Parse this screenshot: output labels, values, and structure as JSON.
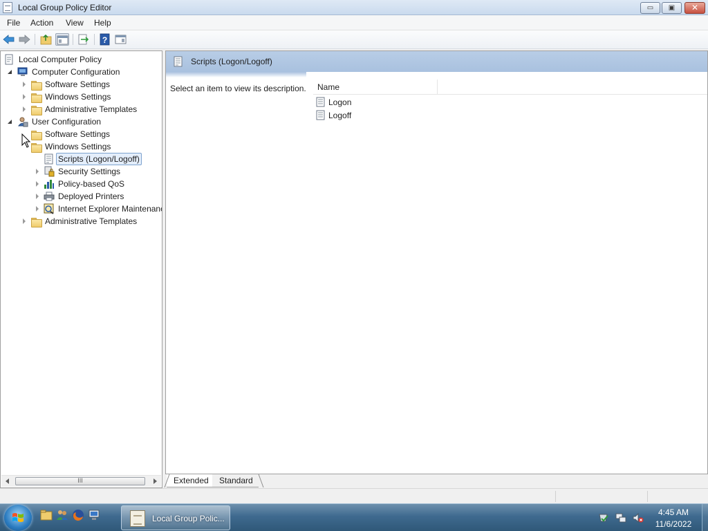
{
  "window": {
    "title": "Local Group Policy Editor",
    "controls": {
      "minimize": "▭",
      "maximize": "▣",
      "close": "✕"
    }
  },
  "menu": {
    "file": "File",
    "action": "Action",
    "view": "View",
    "help": "Help"
  },
  "toolbar": {
    "buttons": [
      "back-arrow-icon",
      "forward-arrow-icon",
      "up-folder-icon",
      "show-hide-tree-icon",
      "export-list-icon",
      "help-icon",
      "show-hide-action-pane-icon"
    ]
  },
  "tree": {
    "root": "Local Computer Policy",
    "computer_config": {
      "label": "Computer Configuration",
      "software": "Software Settings",
      "windows": "Windows Settings",
      "admin": "Administrative Templates"
    },
    "user_config": {
      "label": "User Configuration",
      "software": "Software Settings",
      "windows": "Windows Settings",
      "scripts": "Scripts (Logon/Logoff)",
      "security": "Security Settings",
      "qos": "Policy-based QoS",
      "printers": "Deployed Printers",
      "ie_maint": "Internet Explorer Maintenance",
      "admin": "Administrative Templates"
    },
    "scrollbar_grip": "III"
  },
  "details": {
    "header_title": "Scripts (Logon/Logoff)",
    "description": "Select an item to view its description.",
    "column_name": "Name",
    "items": [
      "Logon",
      "Logoff"
    ]
  },
  "view_tabs": {
    "extended": "Extended",
    "standard": "Standard",
    "selected": "Extended"
  },
  "taskbar": {
    "app_label": "Local Group Polic...",
    "clock_time": "4:45 AM",
    "clock_date": "11/6/2022"
  },
  "colors": {
    "header_band": "#a9c1df",
    "selection": "#e4eefb",
    "taskbar": "#3f6a8f"
  }
}
